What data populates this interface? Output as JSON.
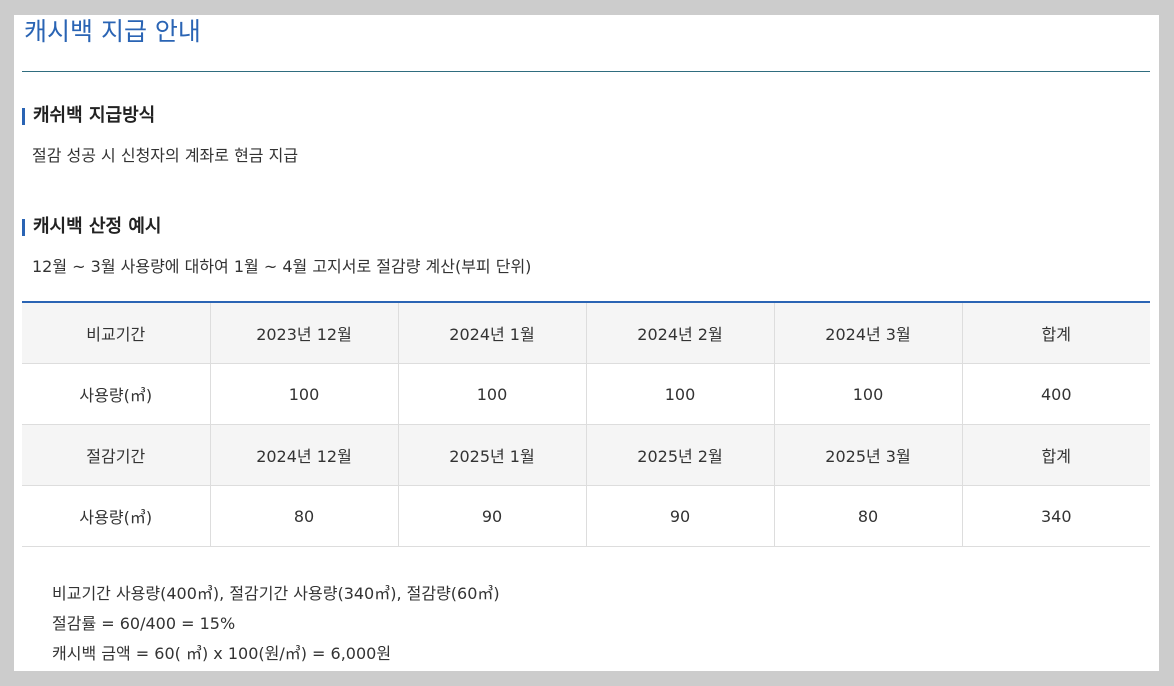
{
  "page": {
    "title": "캐시백 지급 안내"
  },
  "payment_method": {
    "heading": "캐쉬백 지급방식",
    "body": "절감 성공 시 신청자의 계좌로 현금 지급"
  },
  "example": {
    "heading": "캐시백 산정 예시",
    "body": "12월 ~ 3월 사용량에 대하여 1월 ~ 4월 고지서로 절감량 계산(부피 단위)"
  },
  "table": {
    "rows": [
      {
        "cells": [
          "비교기간",
          "2023년 12월",
          "2024년 1월",
          "2024년 2월",
          "2024년 3월",
          "합계"
        ]
      },
      {
        "cells": [
          "사용량(㎥)",
          "100",
          "100",
          "100",
          "100",
          "400"
        ]
      },
      {
        "cells": [
          "절감기간",
          "2024년 12월",
          "2025년 1월",
          "2025년 2월",
          "2025년 3월",
          "합계"
        ]
      },
      {
        "cells": [
          "사용량(㎥)",
          "80",
          "90",
          "90",
          "80",
          "340"
        ]
      }
    ]
  },
  "calculation": {
    "lines": [
      "비교기간 사용량(400㎥), 절감기간 사용량(340㎥), 절감량(60㎥)",
      "절감률 = 60/400 = 15%",
      "캐시백 금액 = 60( ㎥) x 100(원/㎥) = 6,000원"
    ]
  },
  "colors": {
    "accent": "#2a64b4",
    "title_rule": "#2f6d7f",
    "row_shade": "#f5f5f5",
    "frame": "#cccccc"
  }
}
